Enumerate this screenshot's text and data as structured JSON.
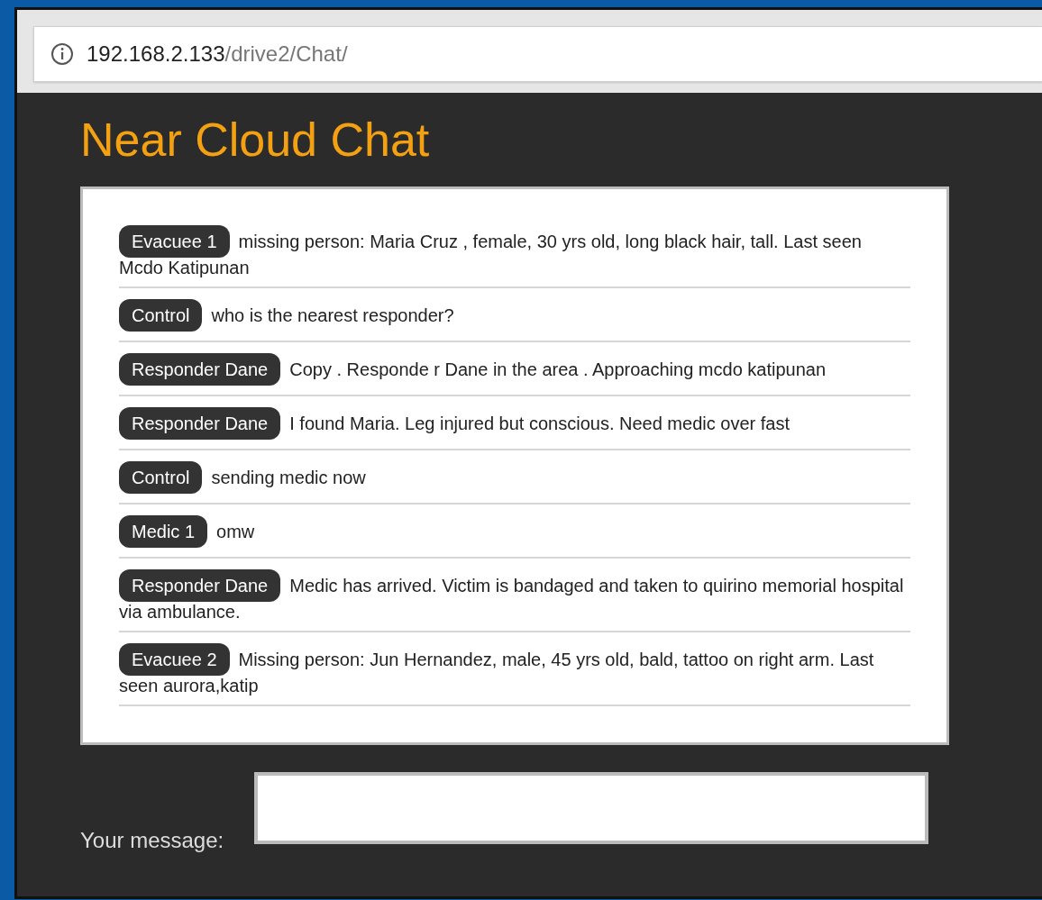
{
  "address_bar": {
    "host": "192.168.2.133",
    "path": "/drive2/Chat/"
  },
  "page": {
    "title": "Near Cloud Chat",
    "messages": [
      {
        "sender": "Evacuee 1",
        "text": "missing person: Maria Cruz , female, 30 yrs old, long black hair, tall. Last seen Mcdo Katipunan"
      },
      {
        "sender": "Control",
        "text": "who is the nearest responder?"
      },
      {
        "sender": "Responder Dane",
        "text": "Copy . Responde r Dane in the area . Approaching mcdo katipunan"
      },
      {
        "sender": "Responder Dane",
        "text": "I found Maria. Leg injured but conscious. Need medic over fast"
      },
      {
        "sender": "Control",
        "text": "sending medic now"
      },
      {
        "sender": "Medic 1",
        "text": "omw"
      },
      {
        "sender": "Responder Dane",
        "text": "Medic has arrived. Victim is bandaged and taken to quirino memorial hospital via ambulance."
      },
      {
        "sender": "Evacuee 2",
        "text": "Missing person: Jun Hernandez, male, 45 yrs old, bald, tattoo on right arm. Last seen aurora,katip"
      }
    ],
    "message_label": "Your message:"
  }
}
